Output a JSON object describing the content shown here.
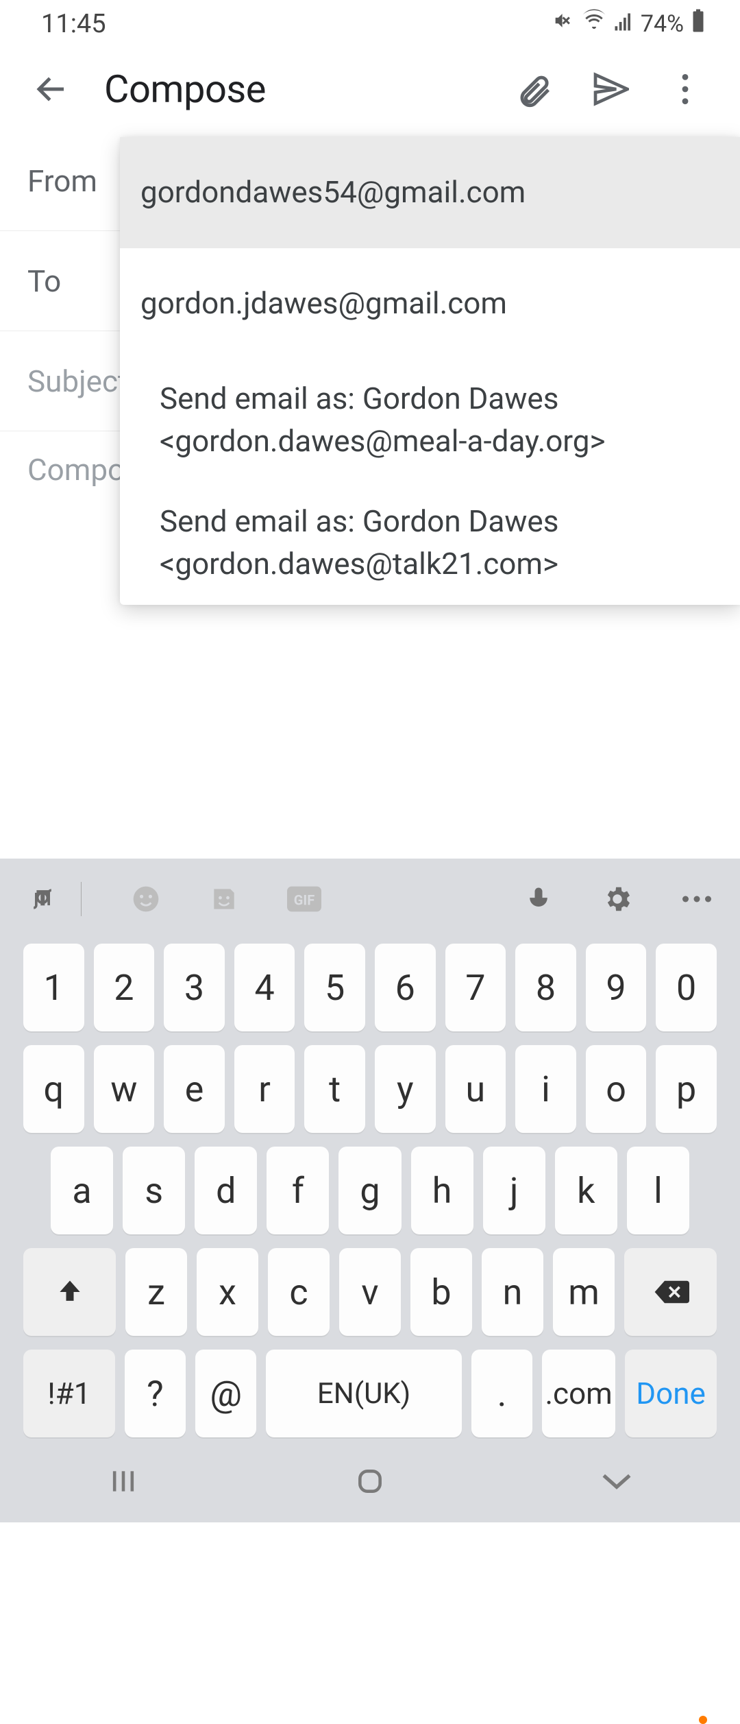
{
  "status": {
    "time": "11:45",
    "battery_pct": "74%"
  },
  "appbar": {
    "title": "Compose"
  },
  "fields": {
    "from_label": "From",
    "to_label": "To",
    "subject_placeholder": "Subject",
    "body_placeholder": "Compose email"
  },
  "from_dropdown": {
    "options": [
      "gordondawes54@gmail.com",
      "gordon.jdawes@gmail.com",
      "Send email as:  Gordon Dawes <gordon.dawes@meal-a-day.org>",
      "Send email as:  Gordon Dawes <gordon.dawes@talk21.com>"
    ]
  },
  "keyboard": {
    "row1": [
      "1",
      "2",
      "3",
      "4",
      "5",
      "6",
      "7",
      "8",
      "9",
      "0"
    ],
    "row2": [
      "q",
      "w",
      "e",
      "r",
      "t",
      "y",
      "u",
      "i",
      "o",
      "p"
    ],
    "row3": [
      "a",
      "s",
      "d",
      "f",
      "g",
      "h",
      "j",
      "k",
      "l"
    ],
    "row4": [
      "z",
      "x",
      "c",
      "v",
      "b",
      "n",
      "m"
    ],
    "sym_key": "!#1",
    "question_key": "?",
    "at_key": "@",
    "space_label": "EN(UK)",
    "dot_key": ".",
    "com_key": ".com",
    "done_key": "Done"
  }
}
